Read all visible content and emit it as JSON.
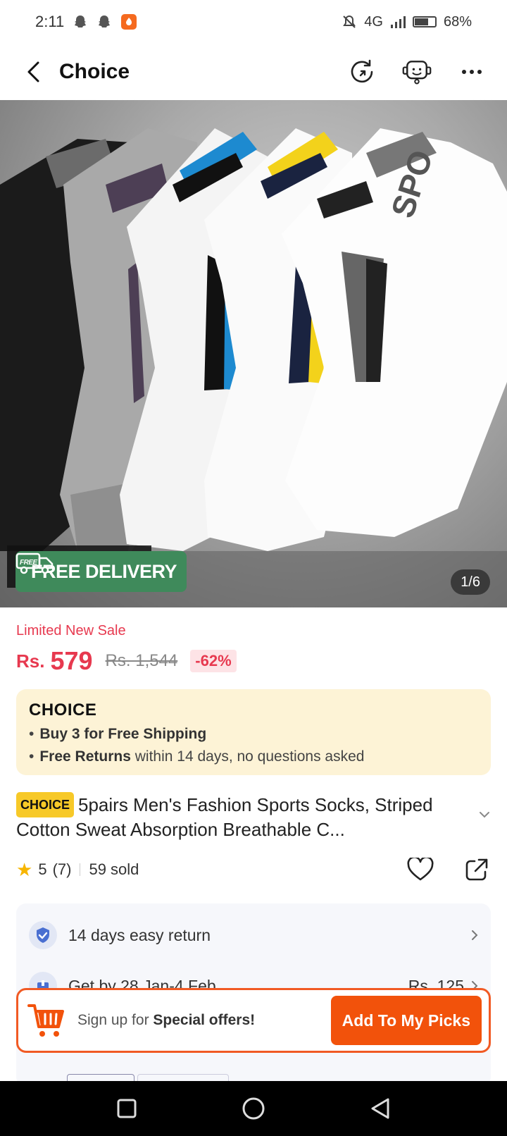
{
  "status_bar": {
    "time": "2:11",
    "network": "4G",
    "battery": "68%",
    "battery_level": 0.68
  },
  "header": {
    "title": "Choice"
  },
  "hero": {
    "badge_label": "FREE DELIVERY",
    "truck_label": "FREE",
    "counter": "1/6"
  },
  "price": {
    "sale_label": "Limited New Sale",
    "currency": "Rs.",
    "current": "579",
    "original": "Rs. 1,544",
    "discount": "-62%"
  },
  "choice_box": {
    "logo": "CHOICE",
    "line1_bold": "Buy 3 for  Free Shipping",
    "line2_bold": "Free Returns",
    "line2_rest": "within 14 days, no questions asked"
  },
  "product": {
    "tag": "CHOICE",
    "title": "5pairs Men's Fashion Sports Socks, Striped Cotton Sweat Absorption Breathable C..."
  },
  "rating": {
    "score": "5",
    "count": "(7)",
    "sold": "59 sold"
  },
  "info": {
    "return_label": "14 days easy return",
    "delivery_label": "Get by 28 Jan-4 Feb",
    "delivery_price": "Rs. 125"
  },
  "promo": {
    "text_prefix": "Sign up for ",
    "text_bold": "Special offers!",
    "button_label": "Add To My Picks"
  },
  "colors": {
    "accent": "#f2520b",
    "price_red": "#e7394f",
    "delivery_green": "#3f8a5b",
    "choice_yellow": "#f7c928"
  }
}
